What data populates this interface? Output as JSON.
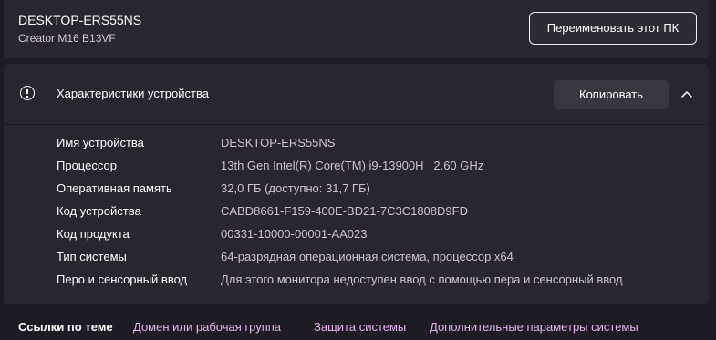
{
  "header": {
    "device_name": "DESKTOP-ERS55NS",
    "model": "Creator M16 B13VF",
    "rename_button": "Переименовать этот ПК"
  },
  "device_specs": {
    "title": "Характеристики устройства",
    "copy_button": "Копировать",
    "expanded": true,
    "rows": [
      {
        "label": "Имя устройства",
        "value": "DESKTOP-ERS55NS"
      },
      {
        "label": "Процессор",
        "value": "13th Gen Intel(R) Core(TM) i9-13900H   2.60 GHz"
      },
      {
        "label": "Оперативная память",
        "value": "32,0 ГБ (доступно: 31,7 ГБ)"
      },
      {
        "label": "Код устройства",
        "value": "CABD8661-F159-400E-BD21-7C3C1808D9FD"
      },
      {
        "label": "Код продукта",
        "value": "00331-10000-00001-AA023"
      },
      {
        "label": "Тип системы",
        "value": "64-разрядная операционная система, процессор x64"
      },
      {
        "label": "Перо и сенсорный ввод",
        "value": "Для этого монитора недоступен ввод с помощью пера и сенсорный ввод"
      }
    ]
  },
  "related_links": {
    "title": "Ссылки по теме",
    "links": [
      "Домен или рабочая группа",
      "Защита системы",
      "Дополнительные параметры системы"
    ]
  },
  "colors": {
    "background": "#1f1b24",
    "card": "#2a2630",
    "link_accent": "#e6b3f0"
  },
  "icons": {
    "info": "info-circle-icon",
    "chevron": "chevron-up-icon"
  }
}
